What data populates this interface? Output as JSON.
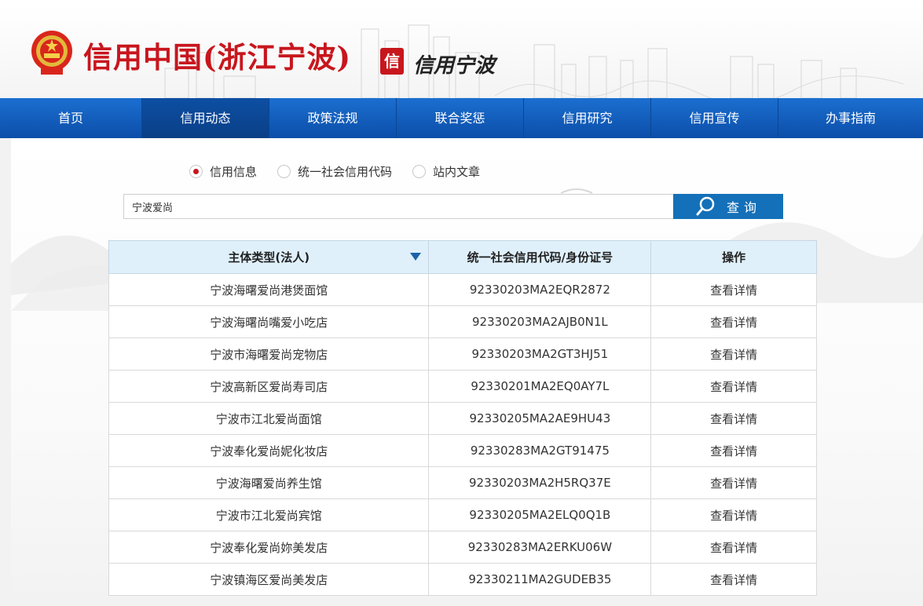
{
  "header": {
    "site_title": "信用中国(浙江宁波)",
    "brand_mark": "信",
    "brand_text": "信用宁波"
  },
  "nav": {
    "items": [
      {
        "label": "首页"
      },
      {
        "label": "信用动态"
      },
      {
        "label": "政策法规"
      },
      {
        "label": "联合奖惩"
      },
      {
        "label": "信用研究"
      },
      {
        "label": "信用宣传"
      },
      {
        "label": "办事指南"
      }
    ],
    "active_index": 1
  },
  "search": {
    "options": [
      {
        "label": "信用信息",
        "checked": true
      },
      {
        "label": "统一社会信用代码",
        "checked": false
      },
      {
        "label": "站内文章",
        "checked": false
      }
    ],
    "query": "宁波爱尚",
    "button_label": "查询"
  },
  "table": {
    "headers": [
      "主体类型(法人)",
      "统一社会信用代码/身份证号",
      "操作"
    ],
    "rows": [
      {
        "name": "宁波海曙爱尚港煲面馆",
        "code": "92330203MA2EQR2872",
        "action": "查看详情"
      },
      {
        "name": "宁波海曙尚嘴爱小吃店",
        "code": "92330203MA2AJB0N1L",
        "action": "查看详情"
      },
      {
        "name": "宁波市海曙爱尚宠物店",
        "code": "92330203MA2GT3HJ51",
        "action": "查看详情"
      },
      {
        "name": "宁波高新区爱尚寿司店",
        "code": "92330201MA2EQ0AY7L",
        "action": "查看详情"
      },
      {
        "name": "宁波市江北爱尚面馆",
        "code": "92330205MA2AE9HU43",
        "action": "查看详情"
      },
      {
        "name": "宁波奉化爱尚妮化妆店",
        "code": "92330283MA2GT91475",
        "action": "查看详情"
      },
      {
        "name": "宁波海曙爱尚养生馆",
        "code": "92330203MA2H5RQ37E",
        "action": "查看详情"
      },
      {
        "name": "宁波市江北爱尚宾馆",
        "code": "92330205MA2ELQ0Q1B",
        "action": "查看详情"
      },
      {
        "name": "宁波奉化爱尚妳美发店",
        "code": "92330283MA2ERKU06W",
        "action": "查看详情"
      },
      {
        "name": "宁波镇海区爱尚美发店",
        "code": "92330211MA2GUDEB35",
        "action": "查看详情"
      }
    ]
  },
  "colors": {
    "brand_red": "#c8161d",
    "nav_blue": "#1b6fd0",
    "button_blue": "#1470b8",
    "table_header_bg": "#dff0fb"
  }
}
